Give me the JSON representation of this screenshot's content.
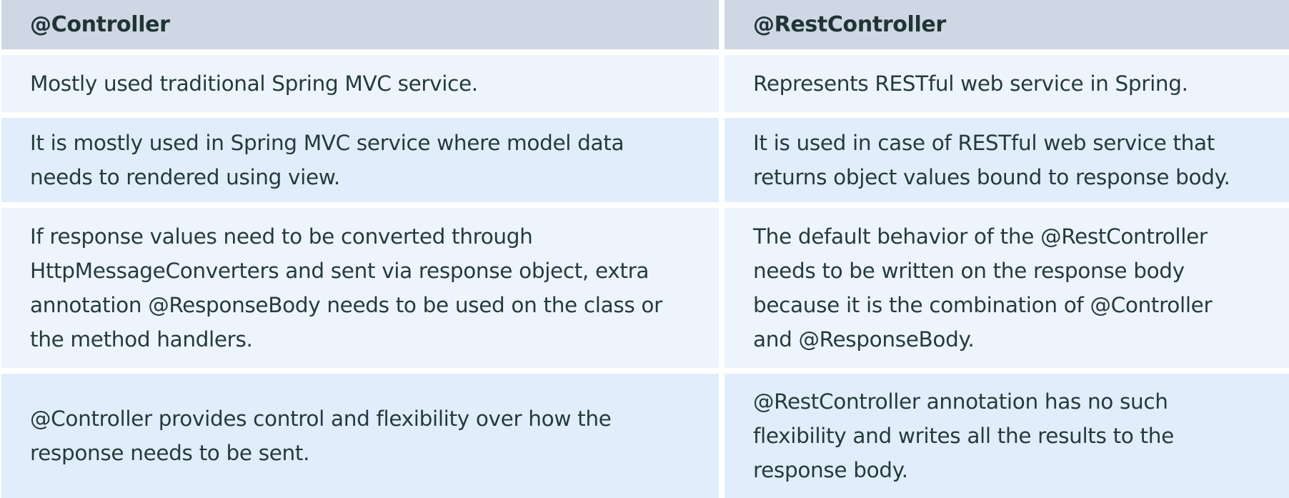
{
  "table": {
    "headers": [
      "@Controller",
      "@RestController"
    ],
    "rows": [
      {
        "controller": "Mostly used traditional Spring MVC service.",
        "rest_controller": "Represents RESTful web service in Spring."
      },
      {
        "controller": "It is mostly used in Spring MVC service where model data\nneeds to rendered using view.",
        "rest_controller": "It is used in case of RESTful web service that\nreturns object values bound to response body."
      },
      {
        "controller": "If response values need to be converted through\nHttpMessageConverters and sent via response object, extra\nannotation @ResponseBody needs to be used on the class or\nthe method handlers.",
        "rest_controller": "The default behavior of the @RestController\nneeds to be written on the response body\nbecause it is the combination of @Controller\nand @ResponseBody."
      },
      {
        "controller": "@Controller provides control and flexibility over how the\nresponse needs to be sent.",
        "rest_controller": "@RestController annotation has no such\nflexibility and writes all the results to the\nresponse body."
      }
    ]
  },
  "colors": {
    "header_bg": "#cfd6e4",
    "row_light_bg": "#eef4fd",
    "row_dark_bg": "#e2edfc",
    "text": "#243b3b"
  }
}
